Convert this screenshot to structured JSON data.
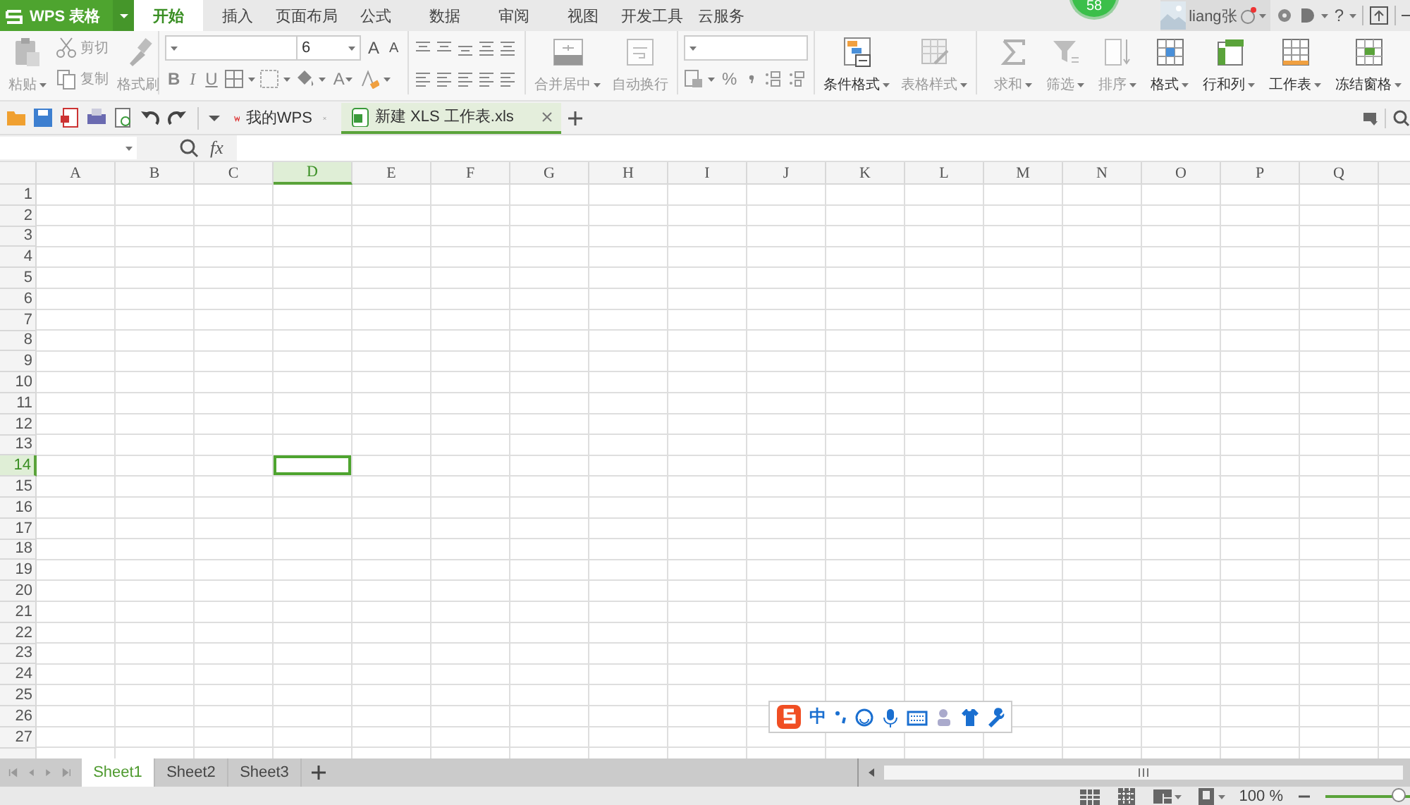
{
  "app_menu": {
    "label": "WPS 表格"
  },
  "menu_tabs": [
    {
      "label": "开始",
      "selected": true
    },
    {
      "label": "插入",
      "selected": false
    },
    {
      "label": "页面布局",
      "selected": false
    },
    {
      "label": "公式",
      "selected": false
    },
    {
      "label": "数据",
      "selected": false
    },
    {
      "label": "审阅",
      "selected": false
    },
    {
      "label": "视图",
      "selected": false
    },
    {
      "label": "开发工具",
      "selected": false
    },
    {
      "label": "云服务",
      "selected": false
    }
  ],
  "badge": "58",
  "user": {
    "name": "liang张"
  },
  "help_label": "?",
  "ribbon": {
    "clipboard": [
      {
        "label": "粘贴",
        "disabled": true
      },
      {
        "label": "剪切",
        "disabled": true
      },
      {
        "label": "复制",
        "disabled": true
      },
      {
        "label": "格式刷",
        "disabled": true
      }
    ],
    "font": {
      "size": "6",
      "grow": "A",
      "shrink": "A",
      "styles": [
        "B",
        "I",
        "U"
      ],
      "font_color_label": "A"
    },
    "merge": [
      {
        "label": "合并居中",
        "disabled": true
      },
      {
        "label": "自动换行",
        "disabled": true
      }
    ],
    "number": {
      "percent": "%"
    },
    "styles": [
      {
        "label": "条件格式",
        "disabled": false
      },
      {
        "label": "表格样式",
        "disabled": true
      }
    ],
    "editing": [
      {
        "label": "求和",
        "disabled": true
      },
      {
        "label": "筛选",
        "disabled": true
      },
      {
        "label": "排序",
        "disabled": true
      },
      {
        "label": "格式",
        "disabled": false
      },
      {
        "label": "行和列",
        "disabled": false
      },
      {
        "label": "工作表",
        "disabled": false
      },
      {
        "label": "冻结窗格",
        "disabled": false
      }
    ]
  },
  "doc_tabs": [
    {
      "label": "我的WPS",
      "selected": false
    },
    {
      "label": "新建 XLS 工作表.xls",
      "selected": true
    }
  ],
  "formula_bar": {
    "function_label": "fx"
  },
  "sheet": {
    "columns": [
      {
        "label": "A",
        "selected": false
      },
      {
        "label": "B",
        "selected": false
      },
      {
        "label": "C",
        "selected": false
      },
      {
        "label": "D",
        "selected": true
      },
      {
        "label": "E",
        "selected": false
      },
      {
        "label": "F",
        "selected": false
      },
      {
        "label": "G",
        "selected": false
      },
      {
        "label": "H",
        "selected": false
      },
      {
        "label": "I",
        "selected": false
      },
      {
        "label": "J",
        "selected": false
      },
      {
        "label": "K",
        "selected": false
      },
      {
        "label": "L",
        "selected": false
      },
      {
        "label": "M",
        "selected": false
      },
      {
        "label": "N",
        "selected": false
      },
      {
        "label": "O",
        "selected": false
      },
      {
        "label": "P",
        "selected": false
      },
      {
        "label": "Q",
        "selected": false
      }
    ],
    "rows": [
      {
        "label": "1",
        "selected": false
      },
      {
        "label": "2",
        "selected": false
      },
      {
        "label": "3",
        "selected": false
      },
      {
        "label": "4",
        "selected": false
      },
      {
        "label": "5",
        "selected": false
      },
      {
        "label": "6",
        "selected": false
      },
      {
        "label": "7",
        "selected": false
      },
      {
        "label": "8",
        "selected": false
      },
      {
        "label": "9",
        "selected": false
      },
      {
        "label": "10",
        "selected": false
      },
      {
        "label": "11",
        "selected": false
      },
      {
        "label": "12",
        "selected": false
      },
      {
        "label": "13",
        "selected": false
      },
      {
        "label": "14",
        "selected": true
      },
      {
        "label": "15",
        "selected": false
      },
      {
        "label": "16",
        "selected": false
      },
      {
        "label": "17",
        "selected": false
      },
      {
        "label": "18",
        "selected": false
      },
      {
        "label": "19",
        "selected": false
      },
      {
        "label": "20",
        "selected": false
      },
      {
        "label": "21",
        "selected": false
      },
      {
        "label": "22",
        "selected": false
      },
      {
        "label": "23",
        "selected": false
      },
      {
        "label": "24",
        "selected": false
      },
      {
        "label": "25",
        "selected": false
      },
      {
        "label": "26",
        "selected": false
      },
      {
        "label": "27",
        "selected": false
      }
    ]
  },
  "sheet_tabs": [
    {
      "label": "Sheet1",
      "selected": true
    },
    {
      "label": "Sheet2",
      "selected": false
    },
    {
      "label": "Sheet3",
      "selected": false
    }
  ],
  "ime_toolbar": {
    "label": "中"
  },
  "status_bar": {
    "zoom": "100 %",
    "zoom_slider": {
      "level": 0.88
    }
  }
}
